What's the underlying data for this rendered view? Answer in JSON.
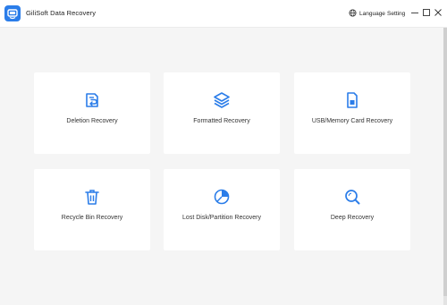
{
  "app": {
    "title": "GiliSoft Data Recovery",
    "accent_color": "#2b7de9"
  },
  "titlebar": {
    "language_label": "Language",
    "setting_label": "Setting",
    "language_icon": "globe-icon",
    "window_controls": [
      "minimize-icon",
      "maximize-icon",
      "close-icon"
    ]
  },
  "cards": [
    {
      "label": "Deletion Recovery",
      "icon": "deleted-file-restore-icon"
    },
    {
      "label": "Formatted Recovery",
      "icon": "layers-icon"
    },
    {
      "label": "USB/Memory Card Recovery",
      "icon": "sd-card-icon"
    },
    {
      "label": "Recycle Bin Recovery",
      "icon": "trash-bin-icon"
    },
    {
      "label": "Lost Disk/Partition Recovery",
      "icon": "partition-pie-icon"
    },
    {
      "label": "Deep Recovery",
      "icon": "magnifier-icon"
    }
  ]
}
